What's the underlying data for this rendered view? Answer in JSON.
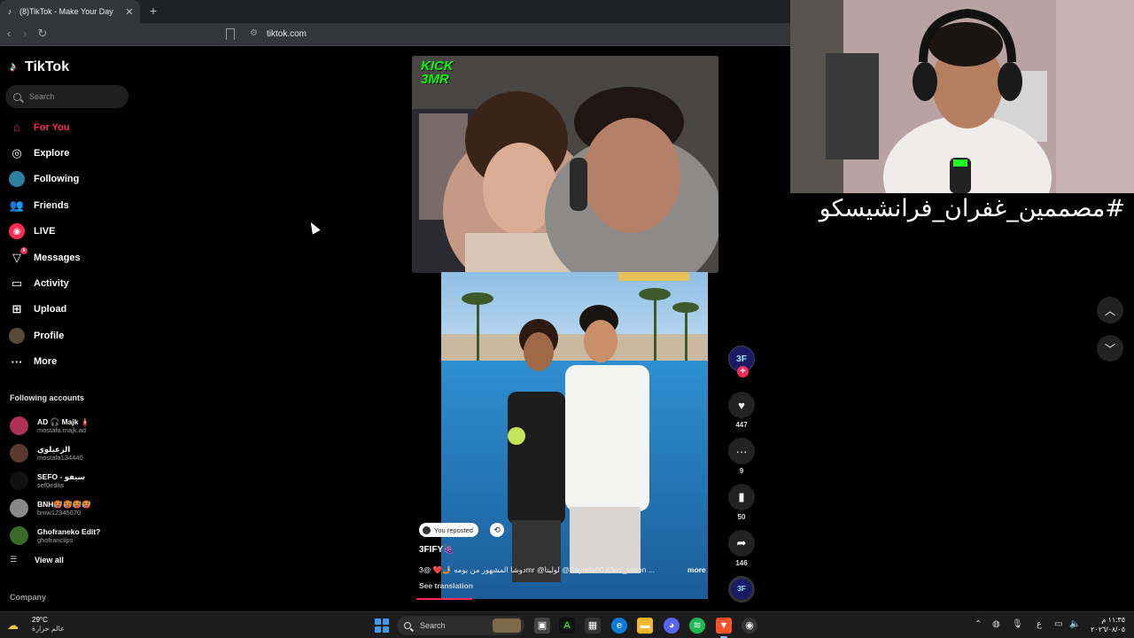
{
  "browser": {
    "tab_title": "(8)TikTok - Make Your Day",
    "tab_close": "✕",
    "new_tab": "+",
    "back": "‹",
    "forward": "›",
    "reload": "↻",
    "url": "tiktok.com"
  },
  "sidebar": {
    "brand": "TikTok",
    "search_placeholder": "Search",
    "nav": [
      {
        "label": "For You",
        "icon": "home-icon",
        "glyph": "⌂",
        "active": true
      },
      {
        "label": "Explore",
        "icon": "compass-icon",
        "glyph": "◎"
      },
      {
        "label": "Following",
        "icon": "following-avatar-icon",
        "glyph": ""
      },
      {
        "label": "Friends",
        "icon": "friends-icon",
        "glyph": "👥"
      },
      {
        "label": "LIVE",
        "icon": "live-icon",
        "glyph": "◉"
      },
      {
        "label": "Messages",
        "icon": "messages-icon",
        "glyph": "▽",
        "badge": "8"
      },
      {
        "label": "Activity",
        "icon": "activity-icon",
        "glyph": "▭"
      },
      {
        "label": "Upload",
        "icon": "upload-icon",
        "glyph": "⊞"
      },
      {
        "label": "Profile",
        "icon": "profile-avatar-icon",
        "glyph": ""
      },
      {
        "label": "More",
        "icon": "more-icon",
        "glyph": "···"
      }
    ],
    "following_title": "Following accounts",
    "accounts": [
      {
        "name": "AD 🎧 Majk 🧯",
        "handle": "mostafa.majk.ad",
        "color": "#b0305a"
      },
      {
        "name": "الزعيلوي",
        "handle": "mostafa134440",
        "color": "#5a3a30"
      },
      {
        "name": "SEFO - سيفو",
        "handle": "sef0edits",
        "color": "#111111"
      },
      {
        "name": "BNH🥵🥵🥵🥵",
        "handle": "bmw12345670",
        "color": "#888888"
      },
      {
        "name": "Ghofraneko Edit?",
        "handle": "ghofranclips",
        "color": "#3a6a2a"
      }
    ],
    "view_all": "View all",
    "company": "Company"
  },
  "video": {
    "reposted_label": "You reposted",
    "author": "3FIFY🍇",
    "caption": "دوشا المشهور من يومه 🤳🏼❤️ @3mr @لوليتا @Sayoda00 #3mr_vision ...",
    "more": "more",
    "see_translation": "See translation",
    "progress": 0.21,
    "kick_text": "KICK\n3MR",
    "stream_overlay_text": "KICK 3MR",
    "author_avatar_text": "3F",
    "likes": "447",
    "comments": "9",
    "saves": "50",
    "shares": "146"
  },
  "webcam": {
    "hashtag": "#مصممين_غفران_فرانشيسكو"
  },
  "taskbar": {
    "temp": "29°C",
    "weather_desc": "عالم حرارة",
    "search": "Search",
    "time": "١١:٣٥ م",
    "date": "٢٠٢٦/٠٨/٠٥",
    "lang": "ع"
  },
  "colors": {
    "accent": "#fe2c55",
    "background": "#000000",
    "chrome": "#35363a"
  }
}
